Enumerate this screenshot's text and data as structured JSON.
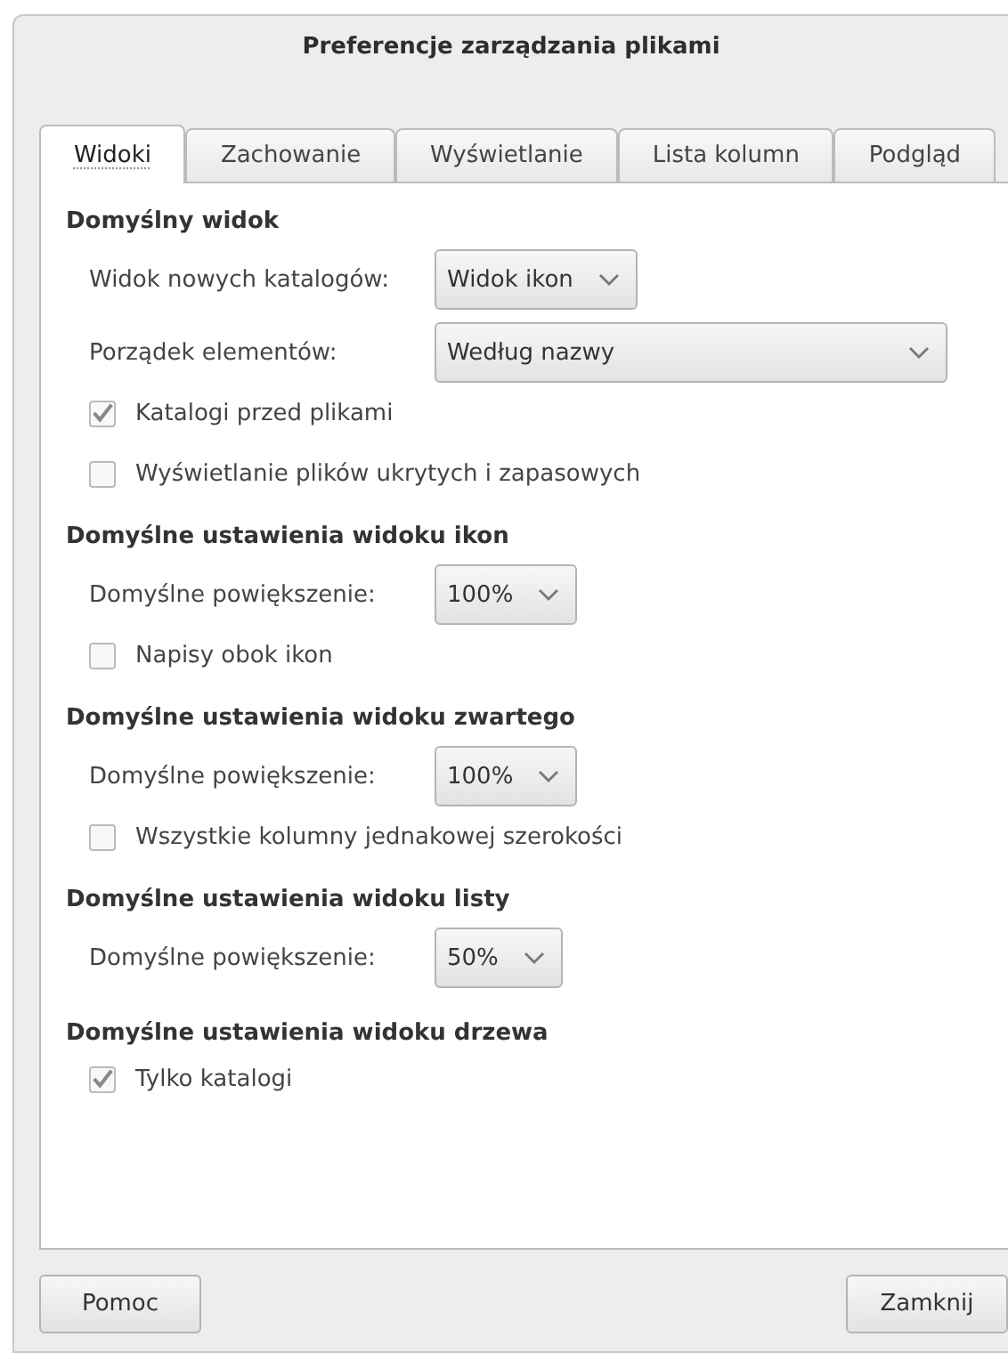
{
  "window": {
    "title": "Preferencje zarządzania plikami"
  },
  "tabs": [
    {
      "label": "Widoki",
      "selected": true
    },
    {
      "label": "Zachowanie",
      "selected": false
    },
    {
      "label": "Wyświetlanie",
      "selected": false
    },
    {
      "label": "Lista kolumn",
      "selected": false
    },
    {
      "label": "Podgląd",
      "selected": false
    }
  ],
  "sections": [
    {
      "heading": "Domyślny widok",
      "rows": [
        {
          "kind": "combo",
          "label": "Widok nowych katalogów:",
          "value": "Widok ikon"
        },
        {
          "kind": "widecombo",
          "label": "Porządek elementów:",
          "value": "Według nazwy"
        },
        {
          "kind": "checkbox",
          "label": "Katalogi przed plikami",
          "checked": true
        },
        {
          "kind": "checkbox",
          "label": "Wyświetlanie plików ukrytych i zapasowych",
          "checked": false
        }
      ]
    },
    {
      "heading": "Domyślne ustawienia widoku ikon",
      "rows": [
        {
          "kind": "combo",
          "label": "Domyślne powiększenie:",
          "value": "100%"
        },
        {
          "kind": "checkbox",
          "label": "Napisy obok ikon",
          "checked": false
        }
      ]
    },
    {
      "heading": "Domyślne ustawienia widoku zwartego",
      "rows": [
        {
          "kind": "combo",
          "label": "Domyślne powiększenie:",
          "value": "100%"
        },
        {
          "kind": "checkbox",
          "label": "Wszystkie kolumny jednakowej szerokości",
          "checked": false
        }
      ]
    },
    {
      "heading": "Domyślne ustawienia widoku listy",
      "rows": [
        {
          "kind": "combo",
          "label": "Domyślne powiększenie:",
          "value": "50%"
        }
      ]
    },
    {
      "heading": "Domyślne ustawienia widoku drzewa",
      "rows": [
        {
          "kind": "checkbox",
          "label": "Tylko katalogi",
          "checked": true
        }
      ]
    }
  ],
  "buttons": [
    {
      "label": "Pomoc"
    },
    {
      "label": "Zamknij"
    }
  ]
}
